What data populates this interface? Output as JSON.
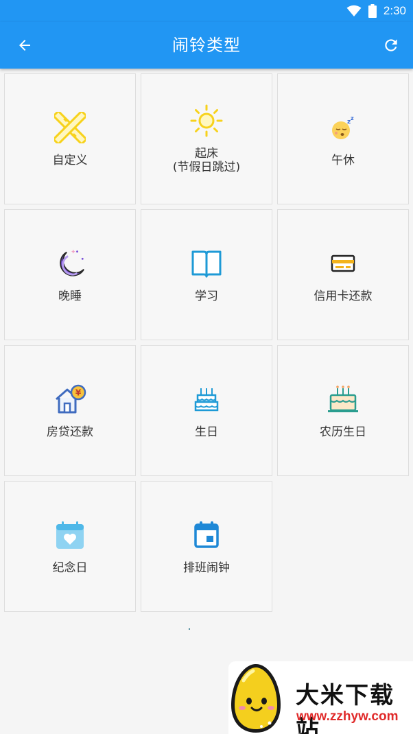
{
  "status_bar": {
    "time": "2:30",
    "bg_color": "#2196f3"
  },
  "app_bar": {
    "title": "闹铃类型",
    "back_icon": "arrow-left-icon",
    "refresh_icon": "refresh-icon"
  },
  "tiles": [
    {
      "label": "自定义",
      "icon": "pencil-ruler-icon"
    },
    {
      "label": "起床",
      "sublabel": "(节假日跳过)",
      "icon": "sun-icon"
    },
    {
      "label": "午休",
      "icon": "sleepy-face-icon"
    },
    {
      "label": "晚睡",
      "icon": "moon-icon"
    },
    {
      "label": "学习",
      "icon": "book-icon"
    },
    {
      "label": "信用卡还款",
      "icon": "credit-card-icon"
    },
    {
      "label": "房贷还款",
      "icon": "house-yen-icon"
    },
    {
      "label": "生日",
      "icon": "cake-icon"
    },
    {
      "label": "农历生日",
      "icon": "lunar-cake-icon"
    },
    {
      "label": "纪念日",
      "icon": "calendar-heart-icon"
    },
    {
      "label": "排班闹钟",
      "icon": "calendar-icon"
    }
  ],
  "watermark": {
    "name": "大米下载站",
    "url": "www.zzhyw.com"
  }
}
